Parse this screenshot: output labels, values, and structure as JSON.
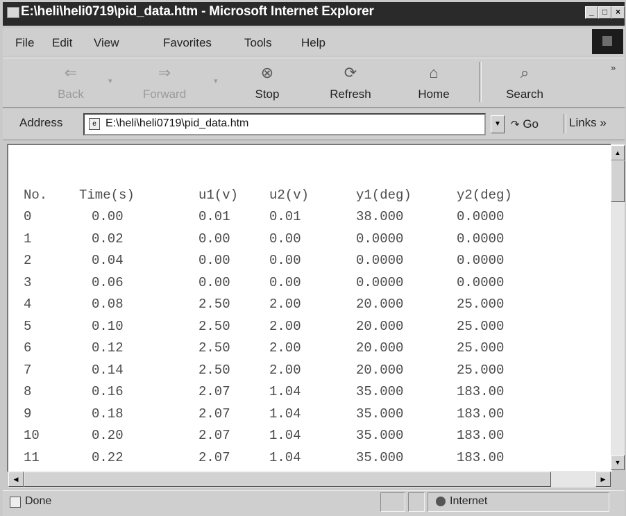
{
  "window": {
    "title": "E:\\heli\\heli0719\\pid_data.htm - Microsoft Internet Explorer",
    "controls": {
      "minimize": "_",
      "maximize": "□",
      "close": "×"
    }
  },
  "menu": [
    "File",
    "Edit",
    "View",
    "Favorites",
    "Tools",
    "Help"
  ],
  "toolbar": {
    "back": {
      "label": "Back",
      "icon": "back-arrow-icon",
      "enabled": false
    },
    "forward": {
      "label": "Forward",
      "icon": "forward-arrow-icon",
      "enabled": false
    },
    "stop": {
      "label": "Stop",
      "icon": "stop-icon"
    },
    "refresh": {
      "label": "Refresh",
      "icon": "refresh-icon"
    },
    "home": {
      "label": "Home",
      "icon": "home-icon"
    },
    "search": {
      "label": "Search",
      "icon": "search-icon"
    },
    "chevron": "»"
  },
  "address": {
    "label": "Address",
    "value": "E:\\heli\\heli0719\\pid_data.htm",
    "go_label": "Go",
    "links_label": "Links »"
  },
  "table": {
    "headers": [
      "No.",
      "Time(s)",
      "u1(v)",
      "u2(v)",
      "y1(deg)",
      "y2(deg)"
    ],
    "rows": [
      [
        "0",
        "0.00",
        "0.01",
        "0.01",
        "38.000",
        "0.0000"
      ],
      [
        "1",
        "0.02",
        "0.00",
        "0.00",
        "0.0000",
        "0.0000"
      ],
      [
        "2",
        "0.04",
        "0.00",
        "0.00",
        "0.0000",
        "0.0000"
      ],
      [
        "3",
        "0.06",
        "0.00",
        "0.00",
        "0.0000",
        "0.0000"
      ],
      [
        "4",
        "0.08",
        "2.50",
        "2.00",
        "20.000",
        "25.000"
      ],
      [
        "5",
        "0.10",
        "2.50",
        "2.00",
        "20.000",
        "25.000"
      ],
      [
        "6",
        "0.12",
        "2.50",
        "2.00",
        "20.000",
        "25.000"
      ],
      [
        "7",
        "0.14",
        "2.50",
        "2.00",
        "20.000",
        "25.000"
      ],
      [
        "8",
        "0.16",
        "2.07",
        "1.04",
        "35.000",
        "183.00"
      ],
      [
        "9",
        "0.18",
        "2.07",
        "1.04",
        "35.000",
        "183.00"
      ],
      [
        "10",
        "0.20",
        "2.07",
        "1.04",
        "35.000",
        "183.00"
      ],
      [
        "11",
        "0.22",
        "2.07",
        "1.04",
        "35.000",
        "183.00"
      ]
    ]
  },
  "status": {
    "text": "Done",
    "zone": "Internet"
  }
}
